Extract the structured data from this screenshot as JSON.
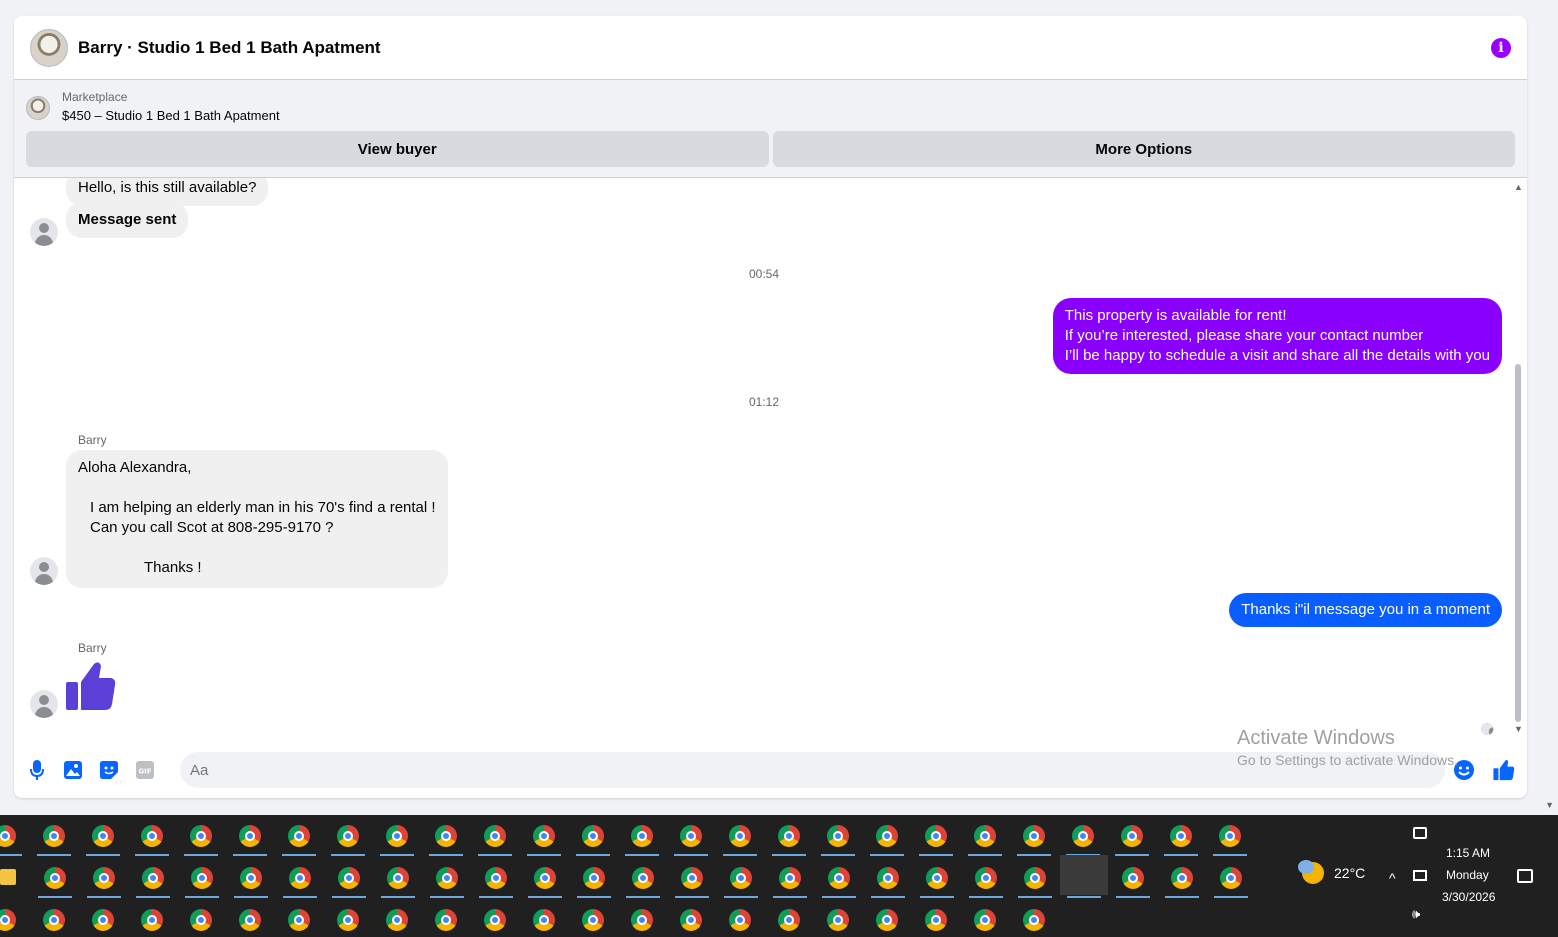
{
  "header": {
    "title": "Barry · Studio 1 Bed 1 Bath Apatment",
    "info_icon": "info-icon"
  },
  "marketplace": {
    "label": "Marketplace",
    "item": "$450 – Studio 1 Bed 1 Bath Apatment",
    "view_buyer": "View buyer",
    "more_options": "More Options"
  },
  "messages": {
    "m1": "Hello, is this still available?",
    "m2": "Message sent",
    "t1": "00:54",
    "out1_line1": "This property is available for rent!",
    "out1_line2": "If you’re interested, please share your contact number",
    "out1_line3": "I’ll be happy to schedule a visit and share all the details with you",
    "t2": "01:12",
    "sender1": "Barry",
    "in_line1": "Aloha Alexandra,",
    "in_line2": "I am helping an elderly man in his 70's find a rental !",
    "in_line3": "Can you call Scot at 808-295-9170 ?",
    "in_line4": "Thanks !",
    "out2": "Thanks i\"il message you in a moment",
    "sender2": "Barry",
    "thumbs_icon": "thumbs-up-icon"
  },
  "composer": {
    "placeholder": "Aa"
  },
  "watermark": {
    "line1": "Activate Windows",
    "line2": "Go to Settings to activate Windows."
  },
  "taskbar": {
    "weather": "22°C",
    "time": "1:15 AM",
    "day": "Monday",
    "date": "3/30/2026"
  },
  "colors": {
    "accent_purple": "#8a00ff",
    "accent_blue": "#0a5eff",
    "icon_blue": "#0866ff"
  }
}
